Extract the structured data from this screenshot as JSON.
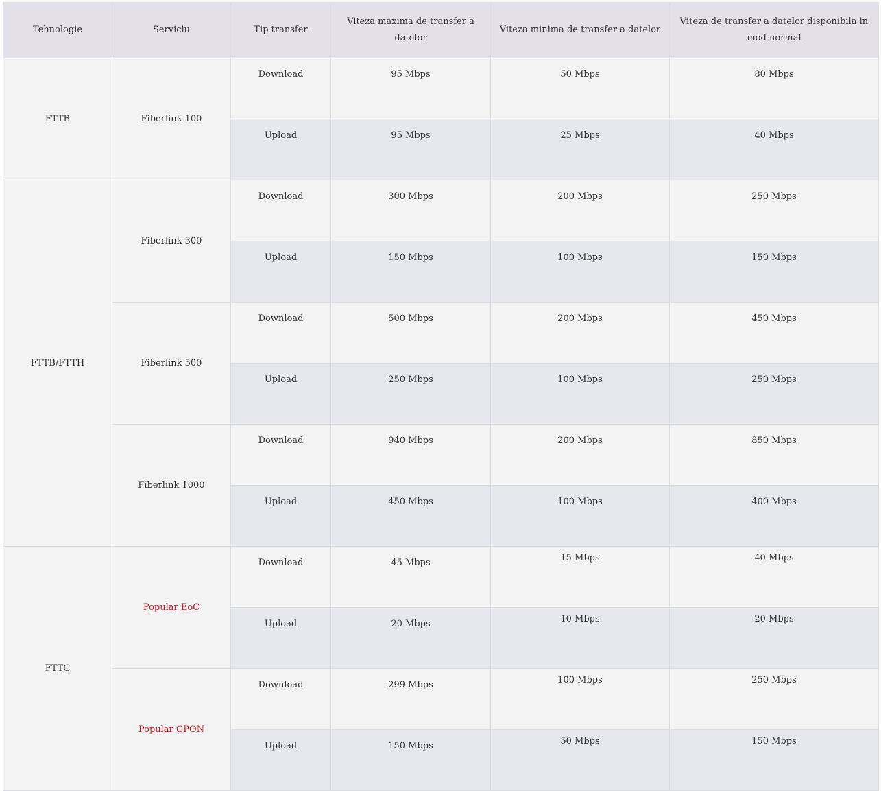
{
  "headers": {
    "tech": "Tehnologie",
    "service": "Serviciu",
    "type": "Tip transfer",
    "max": "Viteza maxima de transfer a datelor",
    "min": "Viteza minima de transfer a  datelor",
    "normal": "Viteza de transfer a datelor disponibila in mod normal"
  },
  "techs": [
    "FTTB",
    "FTTB/FTTH",
    "FTTC"
  ],
  "services": [
    "Fiberlink 100",
    "Fiberlink 300",
    "Fiberlink 500",
    "Fiberlink 1000",
    "Popular EoC",
    "Popular GPON"
  ],
  "rows": [
    {
      "type": "Download",
      "max": "95 Mbps",
      "min": "50 Mbps",
      "normal": "80 Mbps"
    },
    {
      "type": "Upload",
      "max": "95 Mbps",
      "min": "25 Mbps",
      "normal": "40 Mbps"
    },
    {
      "type": "Download",
      "max": "300 Mbps",
      "min": "200 Mbps",
      "normal": "250 Mbps"
    },
    {
      "type": "Upload",
      "max": "150 Mbps",
      "min": "100 Mbps",
      "normal": "150 Mbps"
    },
    {
      "type": "Download",
      "max": "500 Mbps",
      "min": "200 Mbps",
      "normal": "450 Mbps"
    },
    {
      "type": "Upload",
      "max": "250 Mbps",
      "min": "100 Mbps",
      "normal": "250 Mbps"
    },
    {
      "type": "Download",
      "max": "940 Mbps",
      "min": "200 Mbps",
      "normal": "850 Mbps"
    },
    {
      "type": "Upload",
      "max": "450 Mbps",
      "min": "100 Mbps",
      "normal": "400 Mbps"
    },
    {
      "type": "Download",
      "max": "45 Mbps",
      "min": "15 Mbps",
      "normal": "40 Mbps"
    },
    {
      "type": "Upload",
      "max": "20 Mbps",
      "min": "10 Mbps",
      "normal": "20 Mbps"
    },
    {
      "type": "Download",
      "max": "299 Mbps",
      "min": "100 Mbps",
      "normal": "250 Mbps"
    },
    {
      "type": "Upload",
      "max": "150 Mbps",
      "min": "50 Mbps",
      "normal": "150 Mbps"
    }
  ],
  "colors": {
    "header_bg": "#e3e0ea",
    "light_row": "#f3f3f3",
    "dark_row": "#e7e8ed",
    "highlight_text": "#c4171b"
  }
}
